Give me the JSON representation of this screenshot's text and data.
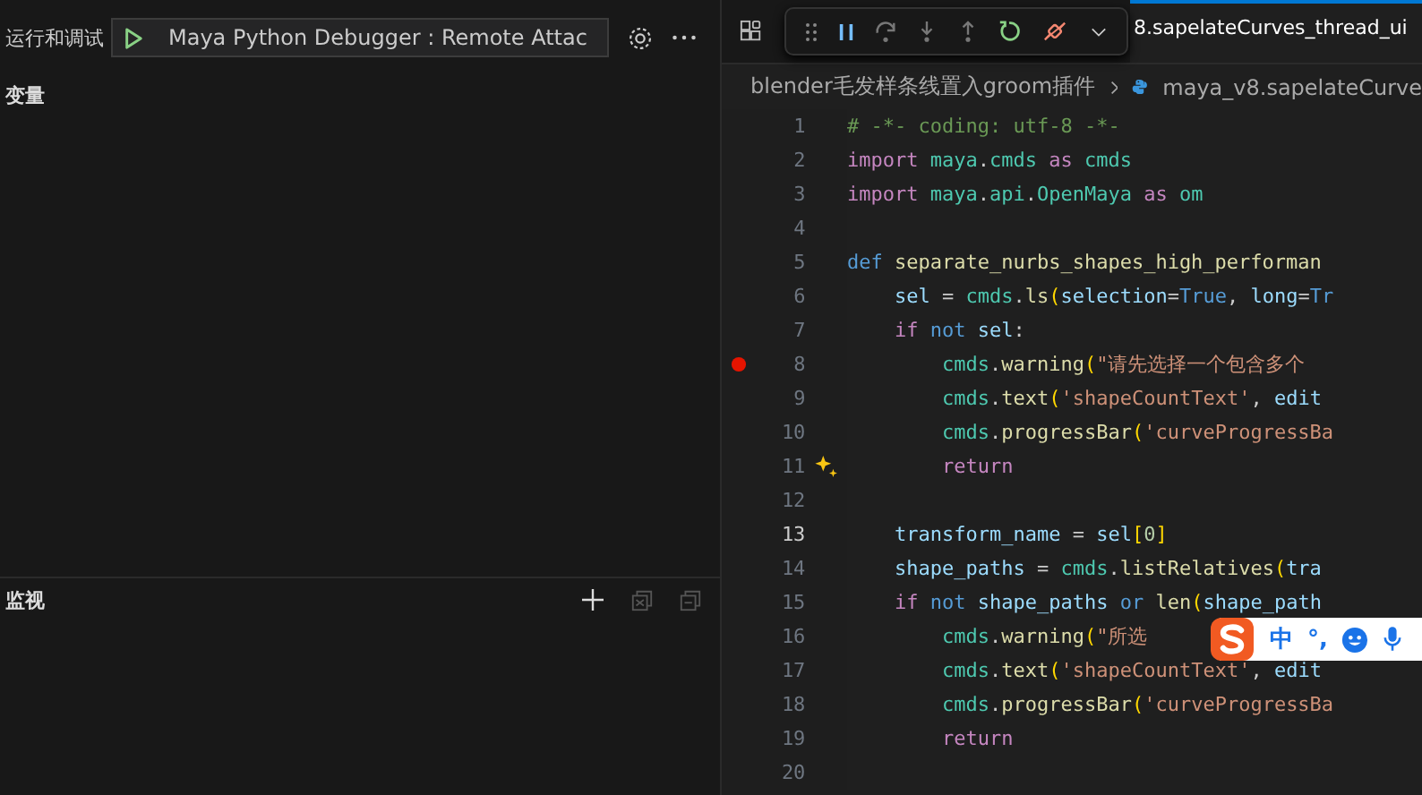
{
  "sidebar": {
    "title": "运行和调试",
    "launch_config": "Maya Python Debugger : Remote Attac",
    "sections": [
      {
        "title": "变量",
        "kind": "variables"
      },
      {
        "title": "监视",
        "kind": "watch"
      }
    ]
  },
  "editor": {
    "tab": {
      "label": "8.sapelateCurves_thread_ui",
      "selected": true
    },
    "breadcrumb": [
      "blender毛发样条线置入groom插件",
      "maya_v8.sapelateCurve"
    ],
    "lines": [
      {
        "number": "1",
        "breakpoint": false,
        "current": false,
        "sparkle": false,
        "segments": [
          {
            "text": "# -*- coding: utf-8 -*-",
            "kind": "comment"
          }
        ]
      },
      {
        "number": "2",
        "breakpoint": false,
        "current": false,
        "sparkle": false,
        "segments": [
          {
            "text": "import",
            "kind": "control"
          },
          {
            "text": " maya",
            "kind": "module"
          },
          {
            "text": ".",
            "kind": "plain"
          },
          {
            "text": "cmds",
            "kind": "module"
          },
          {
            "text": " as",
            "kind": "control"
          },
          {
            "text": " cmds",
            "kind": "module"
          }
        ]
      },
      {
        "number": "3",
        "breakpoint": false,
        "current": false,
        "sparkle": false,
        "segments": [
          {
            "text": "import",
            "kind": "control"
          },
          {
            "text": " maya",
            "kind": "module"
          },
          {
            "text": ".",
            "kind": "plain"
          },
          {
            "text": "api",
            "kind": "module"
          },
          {
            "text": ".",
            "kind": "plain"
          },
          {
            "text": "OpenMaya",
            "kind": "module"
          },
          {
            "text": " as",
            "kind": "control"
          },
          {
            "text": " om",
            "kind": "module"
          }
        ]
      },
      {
        "number": "4",
        "breakpoint": false,
        "current": false,
        "sparkle": false
      },
      {
        "number": "5",
        "breakpoint": false,
        "current": false,
        "sparkle": false,
        "segments": [
          {
            "text": "def",
            "kind": "keyword"
          },
          {
            "text": " separate_nurbs_shapes_high_performan",
            "kind": "function"
          }
        ]
      },
      {
        "number": "6",
        "breakpoint": false,
        "current": false,
        "sparkle": false,
        "segments": [
          {
            "text": "    sel",
            "kind": "variable"
          },
          {
            "text": " = ",
            "kind": "plain"
          },
          {
            "text": "cmds",
            "kind": "module"
          },
          {
            "text": ".",
            "kind": "plain"
          },
          {
            "text": "ls",
            "kind": "function"
          },
          {
            "text": "(",
            "kind": "bracket"
          },
          {
            "text": "selection",
            "kind": "variable"
          },
          {
            "text": "=",
            "kind": "plain"
          },
          {
            "text": "True",
            "kind": "keyword"
          },
          {
            "text": ", ",
            "kind": "plain"
          },
          {
            "text": "long",
            "kind": "variable"
          },
          {
            "text": "=",
            "kind": "plain"
          },
          {
            "text": "Tr",
            "kind": "keyword"
          }
        ]
      },
      {
        "number": "7",
        "breakpoint": false,
        "current": false,
        "sparkle": false,
        "segments": [
          {
            "text": "    if",
            "kind": "control"
          },
          {
            "text": " not",
            "kind": "keyword"
          },
          {
            "text": " sel",
            "kind": "variable"
          },
          {
            "text": ":",
            "kind": "plain"
          }
        ]
      },
      {
        "number": "8",
        "breakpoint": true,
        "current": false,
        "sparkle": false,
        "segments": [
          {
            "text": "        cmds",
            "kind": "module"
          },
          {
            "text": ".",
            "kind": "plain"
          },
          {
            "text": "warning",
            "kind": "function"
          },
          {
            "text": "(",
            "kind": "bracket"
          },
          {
            "text": "\"请先选择一个包含多个",
            "kind": "string"
          }
        ]
      },
      {
        "number": "9",
        "breakpoint": false,
        "current": false,
        "sparkle": false,
        "segments": [
          {
            "text": "        cmds",
            "kind": "module"
          },
          {
            "text": ".",
            "kind": "plain"
          },
          {
            "text": "text",
            "kind": "function"
          },
          {
            "text": "(",
            "kind": "bracket"
          },
          {
            "text": "'shapeCountText'",
            "kind": "string"
          },
          {
            "text": ", ",
            "kind": "plain"
          },
          {
            "text": "edit",
            "kind": "variable"
          }
        ]
      },
      {
        "number": "10",
        "breakpoint": false,
        "current": false,
        "sparkle": false,
        "segments": [
          {
            "text": "        cmds",
            "kind": "module"
          },
          {
            "text": ".",
            "kind": "plain"
          },
          {
            "text": "progressBar",
            "kind": "function"
          },
          {
            "text": "(",
            "kind": "bracket"
          },
          {
            "text": "'curveProgressBa",
            "kind": "string"
          }
        ]
      },
      {
        "number": "11",
        "breakpoint": false,
        "current": false,
        "sparkle": true,
        "segments": [
          {
            "text": "        return",
            "kind": "control"
          }
        ]
      },
      {
        "number": "12",
        "breakpoint": false,
        "current": false,
        "sparkle": false
      },
      {
        "number": "13",
        "breakpoint": false,
        "current": true,
        "sparkle": false,
        "segments": [
          {
            "text": "    transform_name",
            "kind": "variable"
          },
          {
            "text": " = ",
            "kind": "plain"
          },
          {
            "text": "sel",
            "kind": "variable"
          },
          {
            "text": "[",
            "kind": "bracket"
          },
          {
            "text": "0",
            "kind": "number"
          },
          {
            "text": "]",
            "kind": "bracket"
          }
        ]
      },
      {
        "number": "14",
        "breakpoint": false,
        "current": false,
        "sparkle": false,
        "segments": [
          {
            "text": "    shape_paths",
            "kind": "variable"
          },
          {
            "text": " = ",
            "kind": "plain"
          },
          {
            "text": "cmds",
            "kind": "module"
          },
          {
            "text": ".",
            "kind": "plain"
          },
          {
            "text": "listRelatives",
            "kind": "function"
          },
          {
            "text": "(",
            "kind": "bracket"
          },
          {
            "text": "tra",
            "kind": "variable"
          }
        ]
      },
      {
        "number": "15",
        "breakpoint": false,
        "current": false,
        "sparkle": false,
        "segments": [
          {
            "text": "    if",
            "kind": "control"
          },
          {
            "text": " not",
            "kind": "keyword"
          },
          {
            "text": " shape_paths",
            "kind": "variable"
          },
          {
            "text": " or",
            "kind": "keyword"
          },
          {
            "text": " len",
            "kind": "function"
          },
          {
            "text": "(",
            "kind": "bracket"
          },
          {
            "text": "shape_path",
            "kind": "variable"
          }
        ]
      },
      {
        "number": "16",
        "breakpoint": false,
        "current": false,
        "sparkle": false,
        "segments": [
          {
            "text": "        cmds",
            "kind": "module"
          },
          {
            "text": ".",
            "kind": "plain"
          },
          {
            "text": "warning",
            "kind": "function"
          },
          {
            "text": "(",
            "kind": "bracket"
          },
          {
            "text": "\"所选",
            "kind": "string"
          }
        ]
      },
      {
        "number": "17",
        "breakpoint": false,
        "current": false,
        "sparkle": false,
        "segments": [
          {
            "text": "        cmds",
            "kind": "module"
          },
          {
            "text": ".",
            "kind": "plain"
          },
          {
            "text": "text",
            "kind": "function"
          },
          {
            "text": "(",
            "kind": "bracket"
          },
          {
            "text": "'shapeCountText'",
            "kind": "string"
          },
          {
            "text": ", ",
            "kind": "plain"
          },
          {
            "text": "edit",
            "kind": "variable"
          }
        ]
      },
      {
        "number": "18",
        "breakpoint": false,
        "current": false,
        "sparkle": false,
        "segments": [
          {
            "text": "        cmds",
            "kind": "module"
          },
          {
            "text": ".",
            "kind": "plain"
          },
          {
            "text": "progressBar",
            "kind": "function"
          },
          {
            "text": "(",
            "kind": "bracket"
          },
          {
            "text": "'curveProgressBa",
            "kind": "string"
          }
        ]
      },
      {
        "number": "19",
        "breakpoint": false,
        "current": false,
        "sparkle": false,
        "segments": [
          {
            "text": "        return",
            "kind": "control"
          }
        ]
      },
      {
        "number": "20",
        "breakpoint": false,
        "current": false,
        "sparkle": false
      }
    ]
  },
  "ime_toolbar": {
    "items": [
      "中",
      "°,"
    ]
  }
}
